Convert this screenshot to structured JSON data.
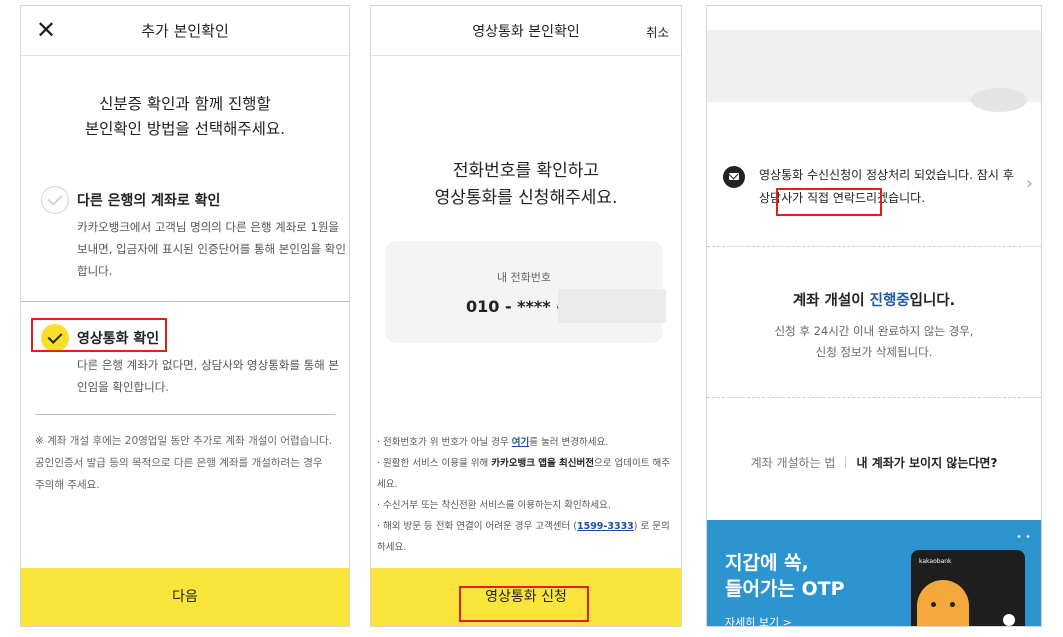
{
  "screen1": {
    "close_icon": "close-icon",
    "title": "추가 본인확인",
    "heading_line1": "신분증 확인과 함께 진행할",
    "heading_line2": "본인확인 방법을 선택해주세요.",
    "option1": {
      "title": "다른 은행의 계좌로 확인",
      "desc": "카카오뱅크에서 고객님 명의의 다른 은행 계좌로 1원을 보내면, 입금자에 표시된 인증단어를 통해 본인임을 확인합니다.",
      "selected": false
    },
    "option2": {
      "title": "영상통화 확인",
      "desc": "다른 은행 계좌가 없다면, 상담사와 영상통화를 통해 본인임을 확인합니다.",
      "selected": true
    },
    "note": "※ 계좌 개설 후에는 20영업일 동안 추가로 계좌 개설이 어렵습니다. 공인인증서 발급 등의 목적으로 다른 은행 계좌를 개설하려는 경우 주의해 주세요.",
    "next_button": "다음",
    "brand_color": "#fbe53a",
    "highlight_color": "#e0201b"
  },
  "screen2": {
    "title": "영상통화 본인확인",
    "cancel": "취소",
    "heading_line1": "전화번호를 확인하고",
    "heading_line2": "영상통화를 신청해주세요.",
    "phone_label": "내 전화번호",
    "phone_number": "010 - **** -",
    "notes": {
      "n1_a": "· 전화번호가 위 번호가 아닐 경우 ",
      "n1_link": "여기",
      "n1_b": "를 눌러 변경하세요.",
      "n2_a": "· 원활한 서비스 이용을 위해 ",
      "n2_bold": "카카오뱅크 앱을 최신버전",
      "n2_b": "으로 업데이트 해주세요.",
      "n3": "· 수신거부 또는 착신전환 서비스를 이용하는지 확인하세요.",
      "n4_a": "· 해외 방문 등 전화 연결이 어려운 경우 고객센터 (",
      "n4_link": "1599-3333",
      "n4_b": ") 로 문의하세요."
    },
    "apply_button": "영상통화 신청"
  },
  "screen3": {
    "message_a": "영상통화 수신신청이 정상처리 되었습니다. 잠시 후 ",
    "message_highlight": "상담사가 직접 연락",
    "message_b": "드리겠습니다.",
    "status_a": "계좌 개설이 ",
    "status_hl": "진행중",
    "status_b": "입니다.",
    "desc_line1": "신청 후 24시간 이내 완료하지 않는 경우,",
    "desc_line2": "신청 정보가 삭제됩니다.",
    "link1": "계좌 개설하는 법",
    "link2": "내 계좌가 보이지 않는다면?",
    "ad_line1": "지갑에 쏙,",
    "ad_line2": "들어가는 OTP",
    "ad_more": "자세히 보기 >",
    "ad_card_logo": "kakaobank",
    "ad_color": "#2c94ce"
  }
}
